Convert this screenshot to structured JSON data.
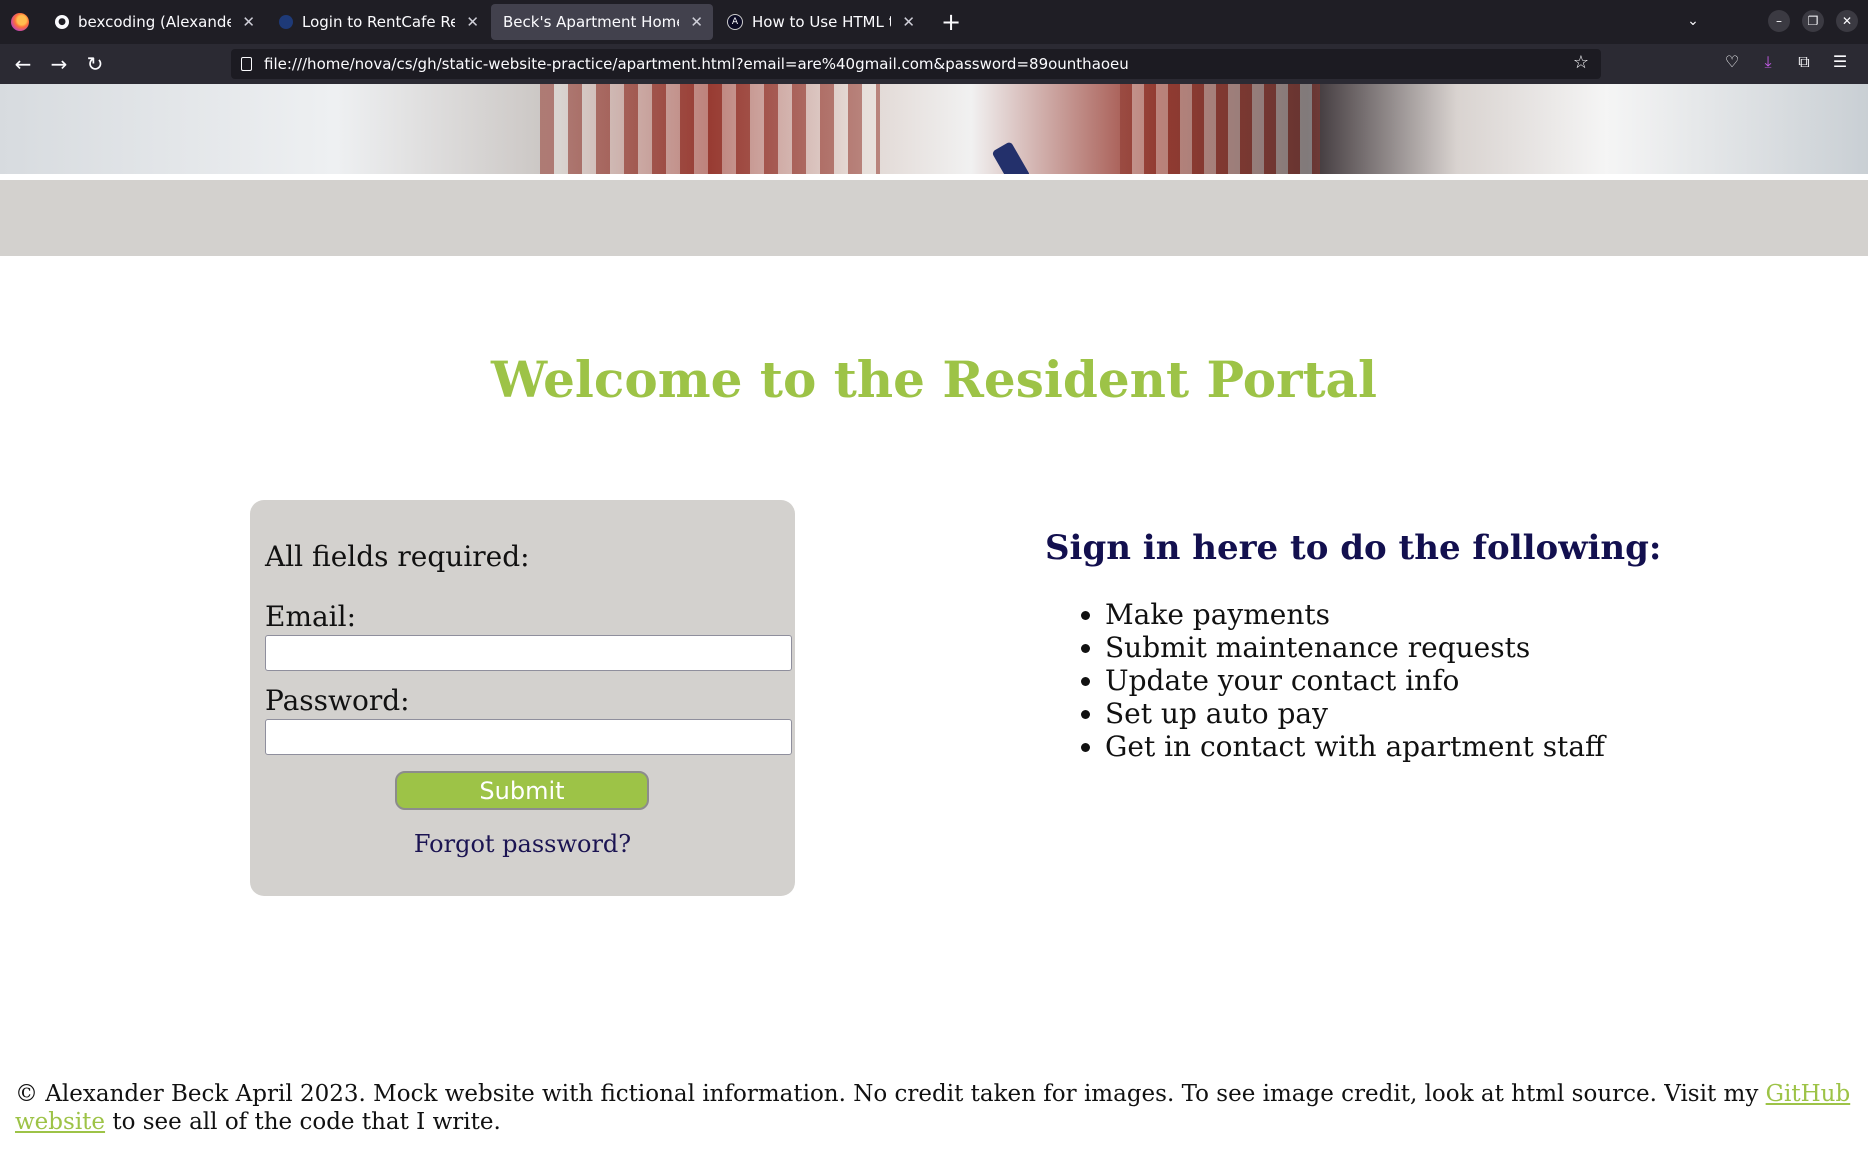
{
  "browser": {
    "tabs": [
      {
        "title": "bexcoding (Alexander Be",
        "favicon": "github-icon"
      },
      {
        "title": "Login to RentCafe Reside",
        "favicon": "rentcafe-icon"
      },
      {
        "title": "Beck's Apartment Homes",
        "favicon": "",
        "active": true
      },
      {
        "title": "How to Use HTML to Ope",
        "favicon": "freecodecamp-icon"
      }
    ],
    "new_tab": "+",
    "url": "file:///home/nova/cs/gh/static-website-practice/apartment.html?email=are%40gmail.com&password=89ounthaoeu"
  },
  "page": {
    "welcome_title": "Welcome to the Resident Portal",
    "login": {
      "required_note": "All fields required:",
      "email_label": "Email:",
      "email_value": "",
      "password_label": "Password:",
      "password_value": "",
      "submit_label": "Submit",
      "forgot_label": "Forgot password?"
    },
    "features": {
      "heading": "Sign in here to do the following:",
      "items": [
        "Make payments",
        "Submit maintenance requests",
        "Update your contact info",
        "Set up auto pay",
        "Get in contact with apartment staff"
      ]
    },
    "footer": {
      "text_before": "© Alexander Beck April 2023. Mock website with fictional information. No credit taken for images. To see image credit, look at html source. Visit my ",
      "link_text": "GitHub website",
      "text_after": " to see all of the code that I write."
    }
  },
  "colors": {
    "accent_green": "#9dc347",
    "heading_navy": "#13104f",
    "panel_grey": "#d3d1ce"
  }
}
